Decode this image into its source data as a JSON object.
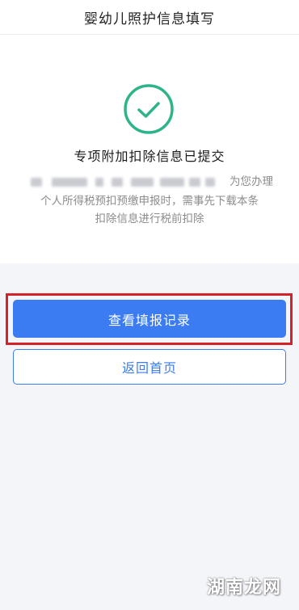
{
  "header": {
    "title": "婴幼儿照护信息填写"
  },
  "result": {
    "icon": "check-circle-icon",
    "title": "专项附加扣除信息已提交",
    "description_suffix": "为您办理",
    "description_lines": [
      "个人所得税预扣预缴申报时，需事先下载本条",
      "扣除信息进行税前扣除"
    ]
  },
  "actions": {
    "primary_label": "查看填报记录",
    "secondary_label": "返回首页"
  },
  "watermark": {
    "text": "湖南龙网"
  },
  "colors": {
    "accent": "#3b7cf2",
    "success": "#2db48a",
    "highlight": "#d4212a"
  }
}
